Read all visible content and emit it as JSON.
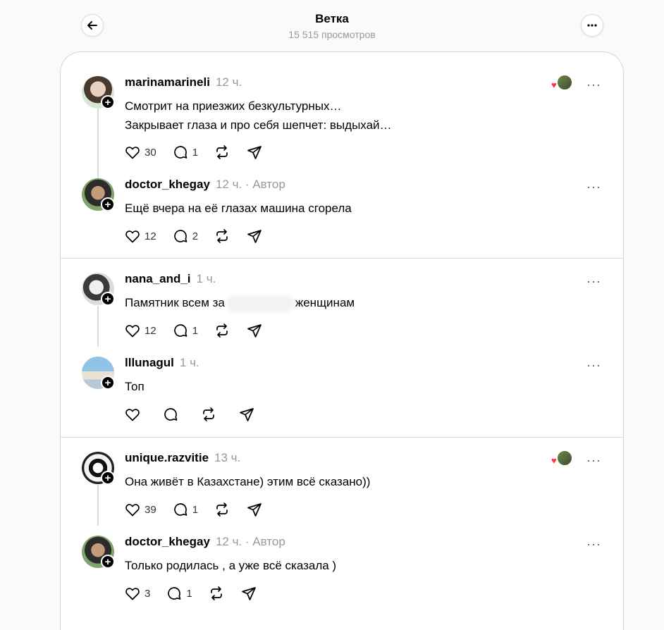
{
  "header": {
    "title": "Ветка",
    "views": "15 515 просмотров",
    "back_icon": "arrow-left-icon",
    "more_icon": "more-horizontal-icon"
  },
  "colors": {
    "accent_heart": "#ff3040",
    "muted_text": "#999999",
    "divider": "#dcdcdc"
  },
  "threads": [
    {
      "posts": [
        {
          "username": "marinamarineli",
          "time": "12 ч.",
          "author_tag": "",
          "text_lines": [
            "Смотрит на приезжих безкультурных…",
            "Закрывает глаза и про себя шепчет: выдыхай…"
          ],
          "likes": "30",
          "replies": "1",
          "liked_by_author": true
        },
        {
          "username": "doctor_khegay",
          "time": "12 ч.",
          "author_tag": "· Автор",
          "text_lines": [
            "Ещё вчера на её глазах машина сгорела"
          ],
          "likes": "12",
          "replies": "2",
          "liked_by_author": false
        }
      ]
    },
    {
      "posts": [
        {
          "username": "nana_and_i",
          "time": "1 ч.",
          "author_tag": "",
          "text_before": "Памятник всем за",
          "text_after": "женщинам",
          "likes": "12",
          "replies": "1",
          "liked_by_author": false
        },
        {
          "username": "lllunagul",
          "time": "1 ч.",
          "author_tag": "",
          "text_lines": [
            "Топ"
          ],
          "likes": "",
          "replies": "",
          "liked_by_author": false
        }
      ]
    },
    {
      "posts": [
        {
          "username": "unique.razvitie",
          "time": "13 ч.",
          "author_tag": "",
          "text_lines": [
            "Она живёт в Казахстане) этим всё сказано))"
          ],
          "likes": "39",
          "replies": "1",
          "liked_by_author": true
        },
        {
          "username": "doctor_khegay",
          "time": "12 ч.",
          "author_tag": "· Автор",
          "text_lines": [
            "Только родилась , а уже всё сказала )"
          ],
          "likes": "3",
          "replies": "1",
          "liked_by_author": false
        }
      ]
    }
  ],
  "icons": {
    "like": "heart-icon",
    "reply": "comment-icon",
    "repost": "repost-icon",
    "share": "send-icon",
    "follow": "plus-icon",
    "post_menu": "more-horizontal-icon"
  }
}
